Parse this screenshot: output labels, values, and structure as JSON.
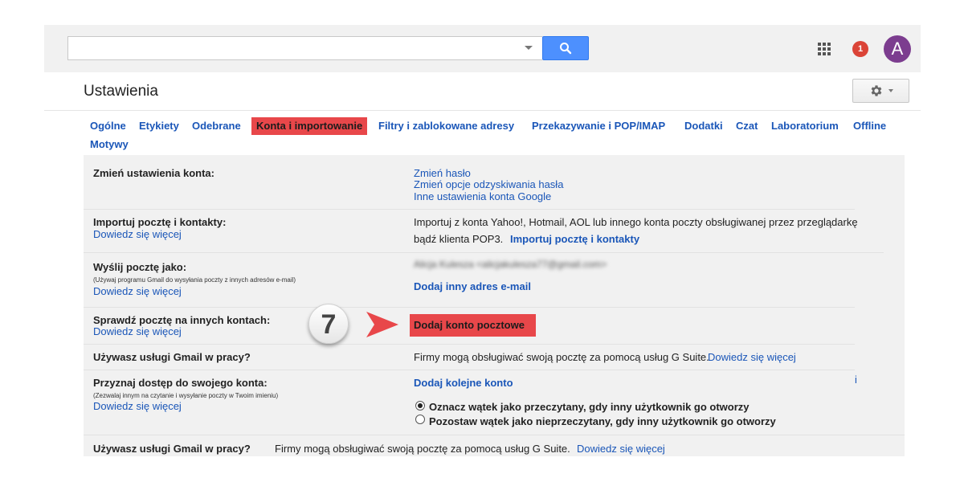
{
  "header": {
    "search_placeholder": "",
    "notification_count": "1",
    "avatar_letter": "A"
  },
  "page": {
    "title": "Ustawienia"
  },
  "tabs": [
    {
      "label": "Ogólne"
    },
    {
      "label": "Etykiety"
    },
    {
      "label": "Odebrane"
    },
    {
      "label": "Konta i importowanie",
      "active": true
    },
    {
      "label": "Filtry i zablokowane adresy"
    },
    {
      "label": "Przekazywanie i POP/IMAP"
    },
    {
      "label": "Dodatki"
    },
    {
      "label": "Czat"
    },
    {
      "label": "Laboratorium"
    },
    {
      "label": "Offline"
    },
    {
      "label": "Motywy"
    }
  ],
  "sections": {
    "account": {
      "label": "Zmień ustawienia konta:",
      "links": [
        "Zmień hasło",
        "Zmień opcje odzyskiwania hasła",
        "Inne ustawienia konta Google"
      ]
    },
    "import": {
      "label": "Importuj pocztę i kontakty:",
      "learn_more": "Dowiedz się więcej",
      "text_line1": "Importuj z konta Yahoo!, Hotmail, AOL lub innego konta poczty obsługiwanej przez przeglądarkę",
      "text_line2": "bądź klienta POP3.",
      "action": "Importuj pocztę i kontakty"
    },
    "send_as": {
      "label": "Wyślij pocztę jako:",
      "sub": "(Używaj programu Gmail do wysyłania poczty z innych adresów e-mail)",
      "learn_more": "Dowiedz się więcej",
      "email": "Alicja Kulesza <alicjakulesza77@gmail.com>",
      "action": "Dodaj inny adres e-mail"
    },
    "check_mail": {
      "label": "Sprawdź pocztę na innych kontach:",
      "learn_more": "Dowiedz się więcej",
      "action": "Dodaj konto pocztowe"
    },
    "work": {
      "label": "Używasz usługi Gmail w pracy?",
      "text": "Firmy mogą obsługiwać swoją pocztę za pomocą usług G Suite.",
      "learn_more": "Dowiedz się więcej"
    },
    "grant": {
      "label": "Przyznaj dostęp do swojego konta:",
      "sub": "(Zezwalaj innym na czytanie i wysyłanie poczty w Twoim imieniu)",
      "learn_more": "Dowiedz się więcej",
      "action": "Dodaj kolejne konto",
      "stray": "i",
      "option1": "Oznacz wątek jako przeczytany, gdy inny użytkownik go otworzy",
      "option2": "Pozostaw wątek jako nieprzeczytany, gdy inny użytkownik go otworzy"
    },
    "work2": {
      "label": "Używasz usługi Gmail w pracy?",
      "text": "Firmy mogą obsługiwać swoją pocztę za pomocą usług G Suite.",
      "learn_more": "Dowiedz się więcej"
    }
  },
  "annotation": {
    "step": "7"
  },
  "colors": {
    "accent": "#4d90fe",
    "link": "#1a56b8",
    "highlight": "#e8474a",
    "avatar": "#7c3d8f",
    "badge": "#db4437"
  }
}
